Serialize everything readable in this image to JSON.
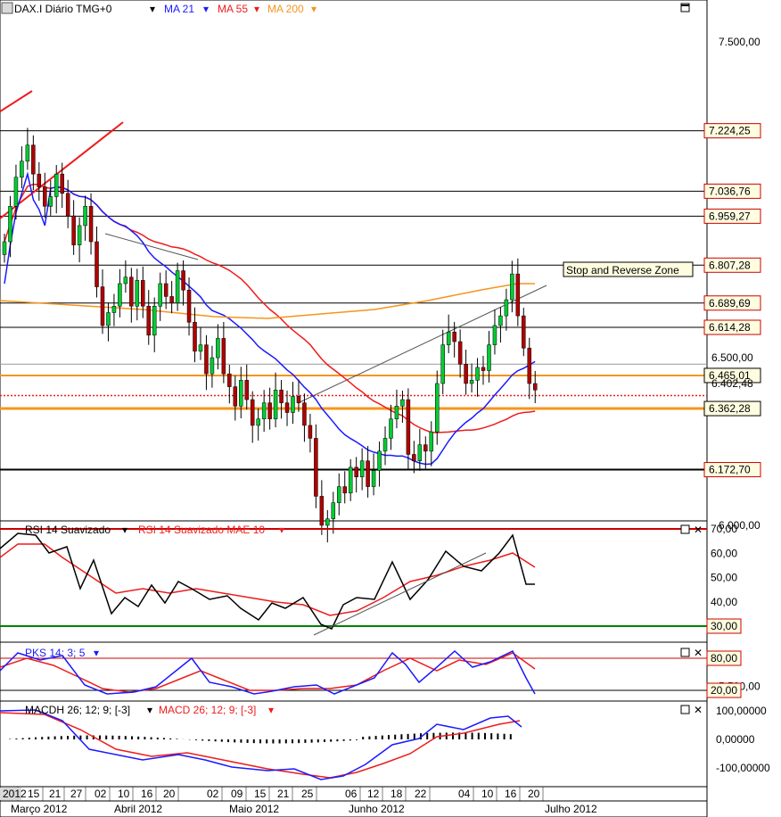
{
  "header": {
    "symbol": "DAX.I Diário TMG+0",
    "ma21": "MA 21",
    "ma55": "MA 55",
    "ma200": "MA 200"
  },
  "annotation": {
    "text": "Stop and Reverse Zone"
  },
  "panels": {
    "rsi": {
      "title": "RSI 14 Suavizado",
      "title2": "RSI 14 Suavizado MAE 10"
    },
    "pks": {
      "title": "PKS 14; 3; 5"
    },
    "macd": {
      "title": "MACDH 26; 12; 9; [-3]",
      "title2": "MACD 26; 12; 9; [-3]"
    }
  },
  "chart_data": [
    {
      "type": "candlestick",
      "title": "DAX.I Diário TMG+0",
      "ylim": [
        5250,
        7780
      ],
      "y_ticks": [
        7500,
        6000,
        5500
      ],
      "y_tick_labels": [
        "7.500,00",
        "6.000,00",
        "5.500,00"
      ],
      "level_labels": [
        {
          "value": 7224.25,
          "label": "7.224,25",
          "color": "#cc0000"
        },
        {
          "value": 7036.76,
          "label": "7.036,76",
          "color": "#cc0000"
        },
        {
          "value": 6959.27,
          "label": "6.959,27",
          "color": "#cc0000"
        },
        {
          "value": 6807.28,
          "label": "6.807,28",
          "color": "#cc0000"
        },
        {
          "value": 6689.69,
          "label": "6.689,69",
          "color": "#cc0000"
        },
        {
          "value": 6614.28,
          "label": "6.614,28",
          "color": "#cc0000"
        },
        {
          "value": 6500.0,
          "label": "6.500,00",
          "color": "#000000"
        },
        {
          "value": 6465.01,
          "label": "6.465,01",
          "color": "#000000"
        },
        {
          "value": 6402.48,
          "label": "6.402,48",
          "color": "#000000"
        },
        {
          "value": 6362.28,
          "label": "6.362,28",
          "color": "#000000"
        },
        {
          "value": 6172.7,
          "label": "6.172,70",
          "color": "#cc0000"
        }
      ],
      "series": [
        {
          "name": "MA 21",
          "color": "#1a1aff"
        },
        {
          "name": "MA 55",
          "color": "#ee1c1c"
        },
        {
          "name": "MA 200",
          "color": "#f7941d"
        }
      ],
      "closes": [
        6880,
        6990,
        7080,
        7130,
        7180,
        7090,
        7050,
        6990,
        7020,
        7090,
        7030,
        6960,
        6870,
        6930,
        6990,
        6880,
        6740,
        6620,
        6660,
        6680,
        6750,
        6770,
        6680,
        6760,
        6680,
        6590,
        6680,
        6750,
        6710,
        6690,
        6790,
        6730,
        6630,
        6540,
        6560,
        6470,
        6520,
        6580,
        6470,
        6430,
        6370,
        6450,
        6390,
        6310,
        6330,
        6380,
        6330,
        6420,
        6380,
        6350,
        6400,
        6380,
        6310,
        6270,
        6090,
        6000,
        6020,
        6070,
        6120,
        6100,
        6180,
        6150,
        6200,
        6120,
        6170,
        6230,
        6270,
        6330,
        6370,
        6390,
        6220,
        6200,
        6250,
        6230,
        6290,
        6440,
        6560,
        6600,
        6570,
        6500,
        6440,
        6450,
        6490,
        6480,
        6560,
        6620,
        6650,
        6700,
        6780,
        6650,
        6550,
        6440,
        6420
      ]
    },
    {
      "type": "line",
      "title": "RSI 14 Suavizado",
      "ylim": [
        25,
        71
      ],
      "y_ticks": [
        70,
        60,
        50,
        40,
        30
      ],
      "y_tick_labels": [
        "70,00",
        "60,00",
        "50,00",
        "40,00",
        "30,00"
      ],
      "series": [
        {
          "name": "RSI 14 Suavizado",
          "color": "#000000"
        },
        {
          "name": "RSI 14 Suavizado MAE 10",
          "color": "#ee1c1c"
        }
      ]
    },
    {
      "type": "line",
      "title": "PKS 14; 3; 5",
      "y_ticks": [
        80,
        20
      ],
      "y_tick_labels": [
        "80,00",
        "20,00"
      ]
    },
    {
      "type": "line",
      "title": "MACDH 26; 12; 9; [-3]",
      "y_ticks": [
        100,
        0,
        -100
      ],
      "y_tick_labels": [
        "100,00000",
        "0,00000",
        "-100,00000"
      ],
      "series": [
        {
          "name": "MACDH 26; 12; 9; [-3]",
          "color": "#000000"
        },
        {
          "name": "MACD 26; 12; 9; [-3]",
          "color": "#ee1c1c"
        }
      ]
    }
  ],
  "x_axis": {
    "day_labels": [
      "2012",
      "15",
      "21",
      "27",
      "02",
      "10",
      "16",
      "20",
      "02",
      "09",
      "15",
      "21",
      "25",
      "06",
      "12",
      "18",
      "22",
      "04",
      "10",
      "16",
      "20"
    ],
    "month_labels": [
      "Março 2012",
      "Abril 2012",
      "Maio 2012",
      "Junho 2012",
      "Julho 2012"
    ]
  }
}
